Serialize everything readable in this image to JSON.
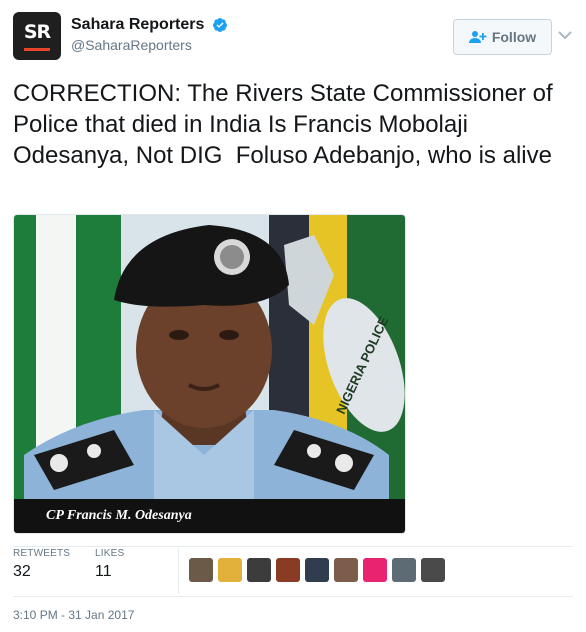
{
  "account": {
    "avatar_text": "SR",
    "display_name": "Sahara Reporters",
    "handle": "@SaharaReporters",
    "verified": true
  },
  "follow_button": {
    "label": "Follow"
  },
  "tweet": {
    "text": "CORRECTION: The Rivers State Commissioner of Police that died in India Is Francis Mobolaji Odesanya, Not DIG  Foluso Adebanjo, who is alive"
  },
  "media": {
    "caption": "CP Francis M. Odesanya",
    "flag_text": "NIGERIA POLICE"
  },
  "stats": {
    "retweets_label": "RETWEETS",
    "retweets_value": "32",
    "likes_label": "LIKES",
    "likes_value": "11"
  },
  "liker_avatars": [
    {
      "color": "#6b5a48"
    },
    {
      "color": "#e1b13a"
    },
    {
      "color": "#3c3c3c"
    },
    {
      "color": "#8a3b24"
    },
    {
      "color": "#2f3d4e"
    },
    {
      "color": "#7c5c4a"
    },
    {
      "color": "#e9236f"
    },
    {
      "color": "#5d6b74"
    },
    {
      "color": "#4a4a4a"
    }
  ],
  "timestamp": "3:10 PM - 31 Jan 2017",
  "colors": {
    "verified": "#1da1f2",
    "follow_text": "#66757f",
    "avatar_bg": "#1f1f1f",
    "avatar_accent": "#e8452c"
  }
}
